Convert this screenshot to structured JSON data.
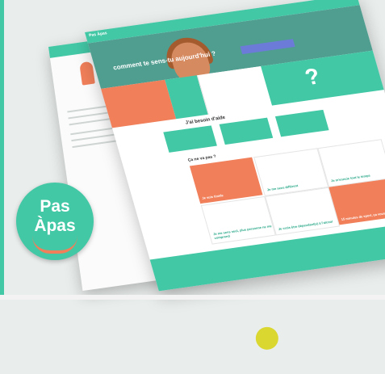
{
  "logo": {
    "line1": "Pas",
    "line2": "Àpas"
  },
  "hero": {
    "text": "comment te sens-tu aujourd'hui ?"
  },
  "header": {
    "logo": "Pas Àpas",
    "menu": ""
  },
  "tiles": {
    "tile1": "",
    "tile2": "",
    "tile3": "",
    "tile4": ""
  },
  "sections": {
    "help_title": "J'ai besoin d'aide",
    "ca_va_title": "Ça ne va pas ?"
  },
  "cards": [
    {
      "label": "Je suis timide"
    },
    {
      "label": "Je me sens différent"
    },
    {
      "label": "Je m'ennuie tout le temps"
    },
    {
      "label": "Je me sens seul, plus personne ne me comprend"
    },
    {
      "label": "Je crois être dépendant(e) à l'alcool"
    },
    {
      "label": "15 minutes de sport, ça vous dit"
    }
  ],
  "footer": {
    "text": ""
  },
  "colors": {
    "teal": "#43c8a6",
    "coral": "#f07f5a"
  }
}
